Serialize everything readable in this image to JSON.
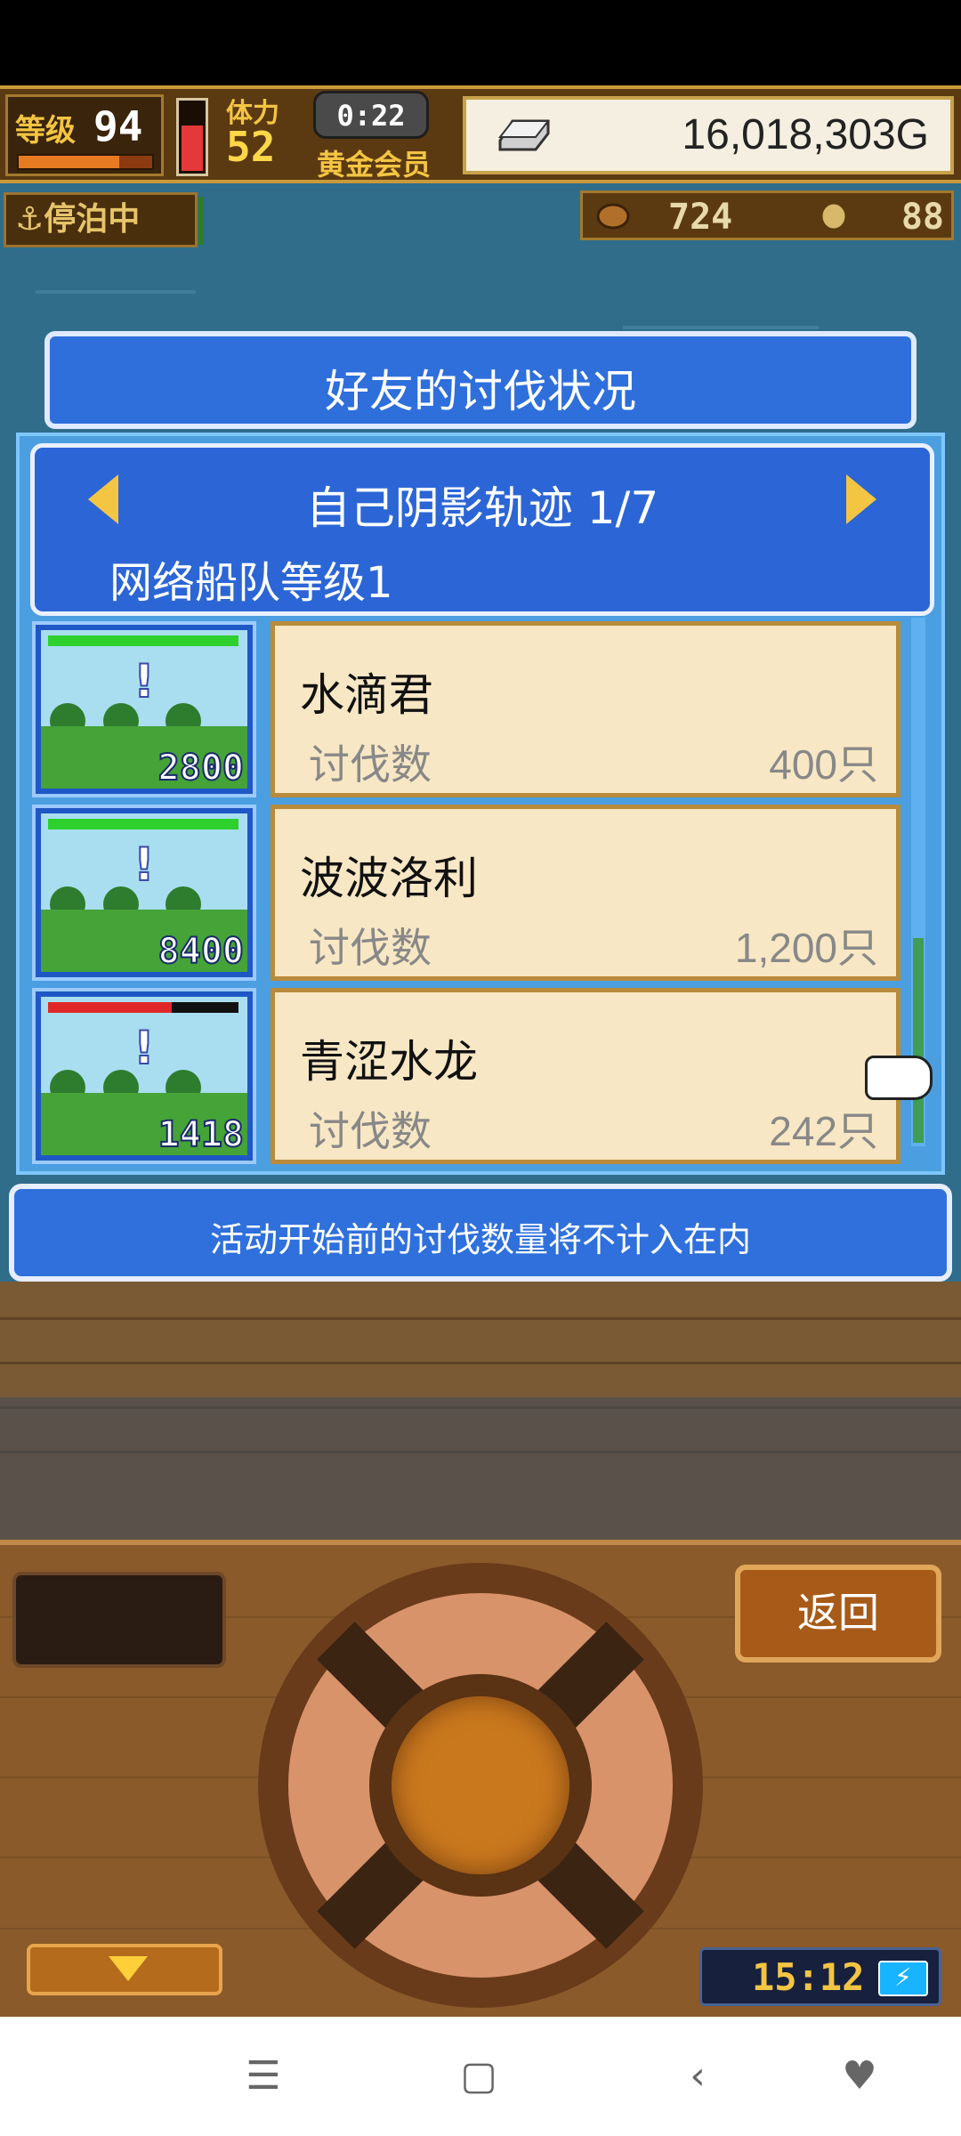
{
  "hud": {
    "level_label": "等级",
    "level_value": "94",
    "level_progress": 0.75,
    "hp_progress": 0.7,
    "stamina_label": "体力",
    "stamina_value": "52",
    "timer": "0:22",
    "membership": "黄金会员",
    "gold": "16,018,303G",
    "status": "停泊中",
    "resource_1": "724",
    "resource_2": "88"
  },
  "dialog": {
    "title": "好友的讨伐状况",
    "subtitle": "自己阴影轨迹 1/7",
    "fleet": "网络船队等级1",
    "items": [
      {
        "name": "水滴君",
        "label": "讨伐数",
        "count": "400只",
        "score": "2800",
        "hp": 1.0,
        "hp_color": "#2ed02e"
      },
      {
        "name": "波波洛利",
        "label": "讨伐数",
        "count": "1,200只",
        "score": "8400",
        "hp": 1.0,
        "hp_color": "#2ed02e"
      },
      {
        "name": "青涩水龙",
        "label": "讨伐数",
        "count": "242只",
        "score": "1418",
        "hp": 0.65,
        "hp_color": "#e02828"
      }
    ],
    "notice": "活动开始前的讨伐数量将不计入在内"
  },
  "controls": {
    "back": "返回",
    "clock": "15:12"
  },
  "icons": {
    "nav": [
      "menu-icon",
      "home-icon",
      "back-icon",
      "assistant-icon"
    ]
  }
}
